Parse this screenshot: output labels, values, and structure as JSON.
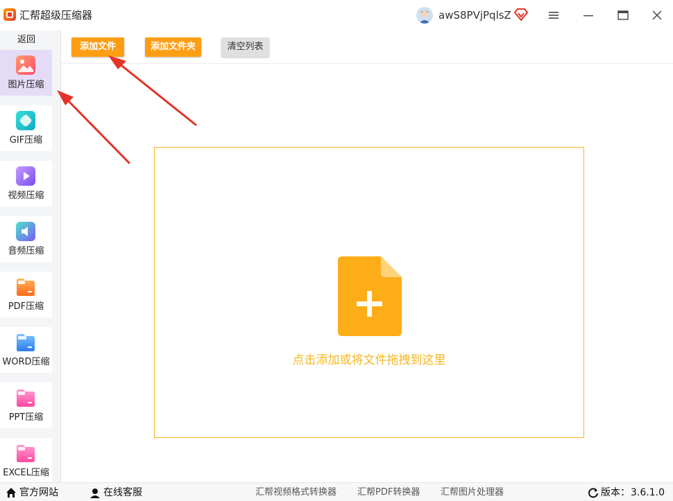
{
  "app": {
    "title": "汇帮超级压缩器",
    "username": "awS8PVjPqlsZ"
  },
  "sidebar": {
    "back_label": "返回",
    "items": [
      {
        "label": "图片压缩",
        "icon": "image-icon",
        "color": "#ff6b6b",
        "active": true
      },
      {
        "label": "GIF压缩",
        "icon": "gif-icon",
        "color": "#22c7c7"
      },
      {
        "label": "视频压缩",
        "icon": "play-icon",
        "color": "#9b6bf2"
      },
      {
        "label": "音频压缩",
        "icon": "speaker-icon",
        "color": "#6a7cf5"
      },
      {
        "label": "PDF压缩",
        "icon": "pdf-folder-icon",
        "color": "#ff7a1a"
      },
      {
        "label": "WORD压缩",
        "icon": "word-folder-icon",
        "color": "#3b8ff5"
      },
      {
        "label": "PPT压缩",
        "icon": "ppt-folder-icon",
        "color": "#ff5aa8"
      },
      {
        "label": "EXCEL压缩",
        "icon": "excel-folder-icon",
        "color": "#ff5aa8"
      }
    ]
  },
  "toolbar": {
    "add_file": "添加文件",
    "add_folder": "添加文件夹",
    "clear_list": "清空列表"
  },
  "dropzone": {
    "hint": "点击添加或将文件拖拽到这里"
  },
  "footer": {
    "official_site": "官方网站",
    "online_support": "在线客服",
    "links": [
      "汇帮视频格式转换器",
      "汇帮PDF转换器",
      "汇帮图片处理器"
    ],
    "version_label": "版本：",
    "version_value": "3.6.1.0"
  },
  "colors": {
    "accent_orange": "#fe9e15",
    "dropzone_border": "#f5b623",
    "annotation_arrow": "#e53227",
    "active_sidebar": "#e4dcf7"
  }
}
